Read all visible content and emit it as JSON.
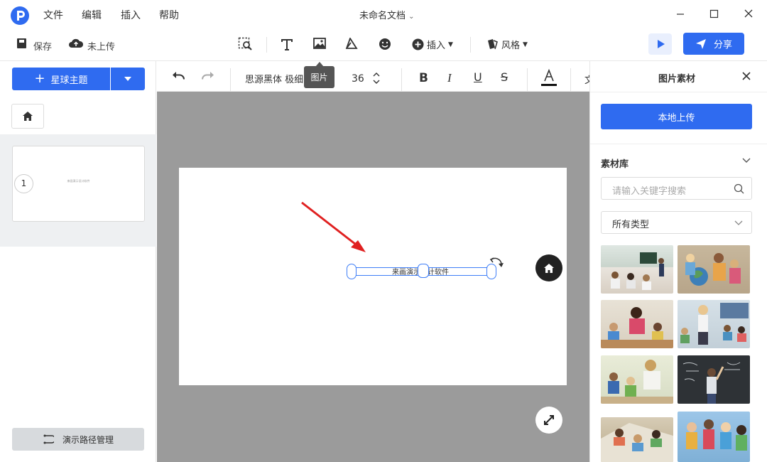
{
  "menu": {
    "file": "文件",
    "edit": "编辑",
    "insert": "插入",
    "help": "帮助"
  },
  "document": {
    "title": "未命名文档"
  },
  "toolbar": {
    "save": "保存",
    "upload_status": "未上传",
    "insert_label": "插入",
    "style_label": "风格",
    "share": "分享"
  },
  "left_panel": {
    "theme_button": "星球主题",
    "slide_number": "1",
    "slide_thumb_text": "来画演示设计软件",
    "path_manage": "演示路径管理"
  },
  "format_bar": {
    "font_family": "思源黑体 极细",
    "font_size": "36",
    "trailing_glyph": "文"
  },
  "tooltip": {
    "text": "图片"
  },
  "canvas": {
    "text_box_content": "来画演示设计软件"
  },
  "right_panel": {
    "title": "图片素材",
    "upload_button": "本地上传",
    "library_title": "素材库",
    "search_placeholder": "请输入关键字搜索",
    "type_select_value": "所有类型"
  },
  "thumbnails": [
    {
      "subject": "classroom-students"
    },
    {
      "subject": "kids-with-globe"
    },
    {
      "subject": "teacher-group-kids"
    },
    {
      "subject": "teacher-standing-classroom"
    },
    {
      "subject": "teacher-helping-kids"
    },
    {
      "subject": "child-at-chalkboard"
    },
    {
      "subject": "students-reading"
    },
    {
      "subject": "kids-group-photo"
    }
  ],
  "colors": {
    "accent": "#2f6bf0",
    "canvas_bg": "#9b9b9b",
    "selection": "#3f7ef7",
    "arrow": "#e02020"
  }
}
